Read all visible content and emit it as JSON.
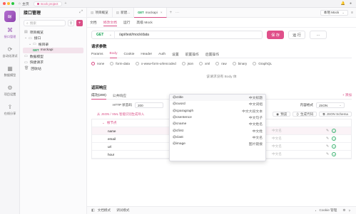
{
  "window": {
    "home_label": "主页",
    "tab_label": "mock project"
  },
  "rail": {
    "items": [
      {
        "label": "接口管理",
        "icon": "api-icon",
        "active": true
      },
      {
        "label": "自动化测试",
        "icon": "auto-test-icon",
        "active": false
      },
      {
        "label": "数据模型",
        "icon": "data-model-icon",
        "active": false
      },
      {
        "label": "项目设置",
        "icon": "settings-icon",
        "active": false
      },
      {
        "label": "在线分享",
        "icon": "share-icon",
        "active": false
      }
    ]
  },
  "sidebar": {
    "title": "接口管理",
    "search_placeholder": "搜索",
    "tree": [
      {
        "label": "项目概览",
        "indent": 0,
        "icon": "overview-icon"
      },
      {
        "label": "接口",
        "indent": 0,
        "icon": "folder-icon",
        "expanded": true
      },
      {
        "label": "根目录",
        "indent": 1,
        "icon": "folder-icon",
        "expanded": true
      },
      {
        "label": "mockapi",
        "indent": 2,
        "method": "GET",
        "selected": true
      },
      {
        "label": "数据模型",
        "indent": 0,
        "icon": "folder-icon"
      },
      {
        "label": "快捷请求",
        "indent": 0,
        "icon": "folder-icon"
      },
      {
        "label": "回收站",
        "indent": 0,
        "icon": "trash-icon"
      }
    ]
  },
  "main": {
    "tabs": [
      {
        "label": "项目概览"
      },
      {
        "label": "新建..."
      },
      {
        "label": "mockapi",
        "method": "GET",
        "active": true
      }
    ],
    "env_label": "本地 Mock",
    "subtabs": [
      "文档",
      "修改文档",
      "运行",
      "高级 Mock"
    ],
    "active_subtab": "修改文档",
    "request": {
      "method": "GET",
      "url": "/api/test/mock/data",
      "save_label": "保 存",
      "run_label": "运 行"
    },
    "params_title": "请求参数",
    "param_tabs": [
      "Params",
      "Body",
      "Cookie",
      "Header",
      "Auth",
      "设置",
      "前置操作",
      "后置操作"
    ],
    "active_param_tab": "Body",
    "body_types": [
      "none",
      "form-data",
      "x-www-form-urlencoded",
      "json",
      "xml",
      "raw",
      "binary",
      "GraphQL"
    ],
    "selected_body_type": "none",
    "no_body_text": "该请求没有 Body 体",
    "response_title": "返回响应",
    "response_tabs": [
      "成功(200)",
      "公共响应"
    ],
    "add_label": "+ 添加",
    "http_status_label": "HTTP 状态码",
    "http_status_value": "200",
    "content_type_label": "内容格式",
    "content_type_value": "JSON",
    "json_import_label": "从 JSON / XML 智能识别生成导入",
    "preview_label": "预览",
    "gen_code_label": "生成代码",
    "json_schema_label": "JSON Schema",
    "root_label": "根节点",
    "fields": [
      {
        "name": "name",
        "type": "string",
        "mock": "Mock",
        "desc": "中文名",
        "mock_placeholder": true
      },
      {
        "name": "email",
        "type": "string",
        "mock": "@email",
        "desc": "中文名"
      },
      {
        "name": "url",
        "type": "string",
        "mock": "@url(\"http\")",
        "desc": "中文名"
      },
      {
        "name": "hour",
        "type": "string",
        "mock": "@now(\"hour\")",
        "desc": "中文名"
      }
    ]
  },
  "mock_dropdown": {
    "items": [
      {
        "key": "@ctitle",
        "desc": "中文标题"
      },
      {
        "key": "@cword",
        "desc": "中文词组"
      },
      {
        "key": "@cparagraph",
        "desc": "中文大段文本"
      },
      {
        "key": "@csentence",
        "desc": "中文句子"
      },
      {
        "key": "@cname",
        "desc": "中文姓名"
      },
      {
        "key": "@cfirst",
        "desc": "中文姓"
      },
      {
        "key": "@clast",
        "desc": "中文名"
      },
      {
        "key": "@image",
        "desc": "图片链接"
      }
    ]
  },
  "statusbar": {
    "left_items": [
      "文档模式",
      "调试模式"
    ],
    "cookie_label": "Cookie 管理"
  },
  "colors": {
    "accent": "#d94e86",
    "get": "#12a150",
    "brand": "#9b59b6"
  }
}
